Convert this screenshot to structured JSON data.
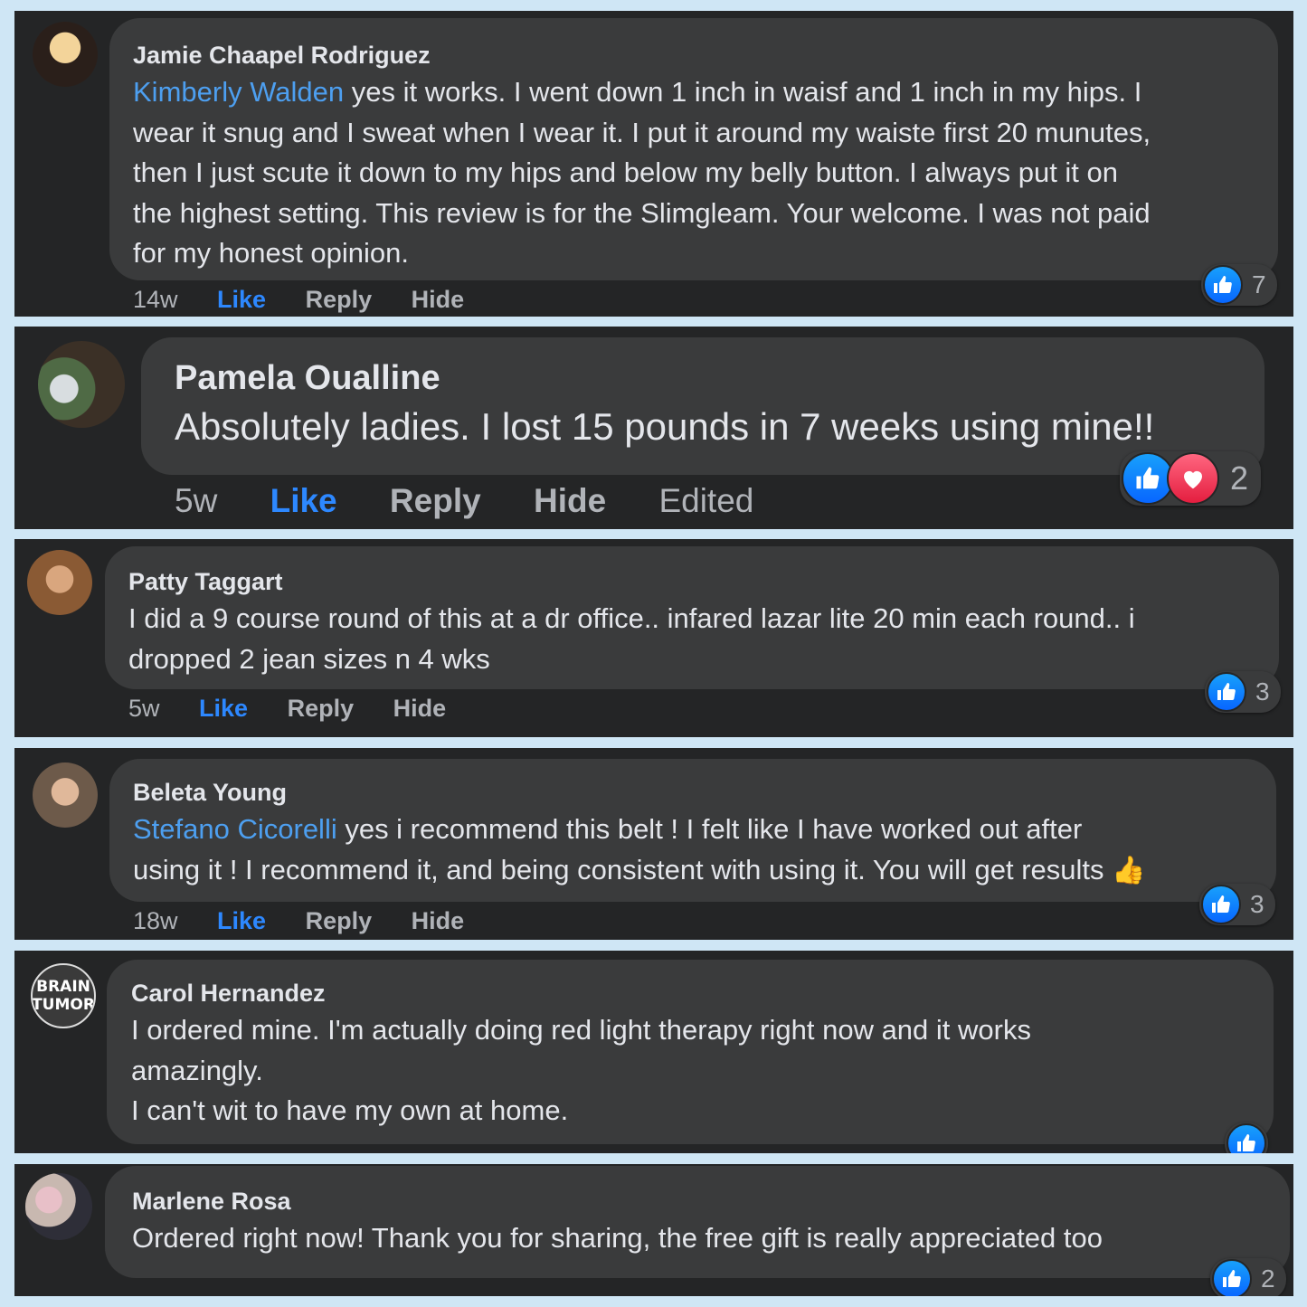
{
  "comments": [
    {
      "name": "Jamie Chaapel Rodriguez",
      "mention": "Kimberly Walden",
      "lines": [
        " yes it works. I went down 1 inch in waisf and 1 inch in my hips. I",
        "wear it snug and I sweat when I wear it. I put it around my waiste first 20 munutes,",
        "then I just scute it down to my hips and below my belly button. I always put it on",
        "the highest setting. This review is for the Slimgleam. Your welcome. I was not paid",
        "for my honest opinion."
      ],
      "time": "14w",
      "like": "Like",
      "reply": "Reply",
      "hide": "Hide",
      "reaction_count": "7"
    },
    {
      "name": "Pamela Oualline",
      "lines": [
        "Absolutely ladies. I lost 15 pounds in 7 weeks using mine!!"
      ],
      "time": "5w",
      "like": "Like",
      "reply": "Reply",
      "hide": "Hide",
      "edited": "Edited",
      "reaction_count": "2"
    },
    {
      "name": "Patty Taggart",
      "lines": [
        "I did a 9 course round of this at a dr office.. infared lazar lite 20 min each round.. i",
        "dropped 2 jean sizes n 4 wks"
      ],
      "time": "5w",
      "like": "Like",
      "reply": "Reply",
      "hide": "Hide",
      "reaction_count": "3"
    },
    {
      "name": "Beleta Young",
      "mention": "Stefano Cicorelli",
      "lines": [
        " yes i recommend this belt ! I felt like I have worked out after",
        "using it ! I recommend it, and being consistent with using it. You will get results"
      ],
      "emoji": "👍",
      "time": "18w",
      "like": "Like",
      "reply": "Reply",
      "hide": "Hide",
      "reaction_count": "3"
    },
    {
      "name": "Carol Hernandez",
      "avatar_text": [
        "BRAIN",
        "TUMOR"
      ],
      "lines": [
        "I ordered mine. I'm actually doing red light therapy right now and it works",
        "amazingly.",
        "I can't wit to have my own at home."
      ]
    },
    {
      "name": "Marlene Rosa",
      "lines": [
        "Ordered right now! Thank you for sharing, the free gift is really appreciated too"
      ],
      "reaction_count": "2"
    }
  ],
  "colors": {
    "background": "#cfe6f5",
    "card": "#242526",
    "bubble": "#3a3b3c",
    "text": "#e4e6eb",
    "mention": "#4d9ff0",
    "like": "#2d88ff",
    "muted": "#b0b3b8"
  }
}
